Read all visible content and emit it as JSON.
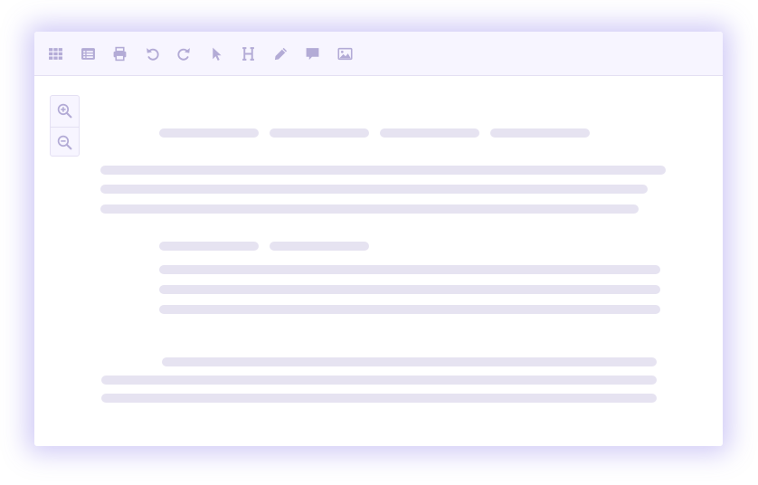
{
  "colors": {
    "icon": "#b3abd6",
    "toolbar_bg": "#f7f5ff",
    "placeholder_bar": "#e6e3f1",
    "shadow_accent": "#7868e6"
  },
  "toolbar": {
    "buttons": [
      {
        "name": "grid-button",
        "icon": "grid-icon"
      },
      {
        "name": "table-button",
        "icon": "table-icon"
      },
      {
        "name": "print-button",
        "icon": "printer-icon"
      },
      {
        "name": "undo-button",
        "icon": "undo-icon"
      },
      {
        "name": "redo-button",
        "icon": "redo-icon"
      },
      {
        "name": "select-button",
        "icon": "cursor-icon"
      },
      {
        "name": "heading-button",
        "icon": "heading-icon"
      },
      {
        "name": "draw-button",
        "icon": "pencil-icon"
      },
      {
        "name": "comment-button",
        "icon": "comment-icon"
      },
      {
        "name": "image-button",
        "icon": "image-icon"
      }
    ]
  },
  "zoom": {
    "zoom_in": {
      "icon": "zoom-in-icon"
    },
    "zoom_out": {
      "icon": "zoom-out-icon"
    }
  },
  "document": {
    "state": "loading-skeleton"
  }
}
